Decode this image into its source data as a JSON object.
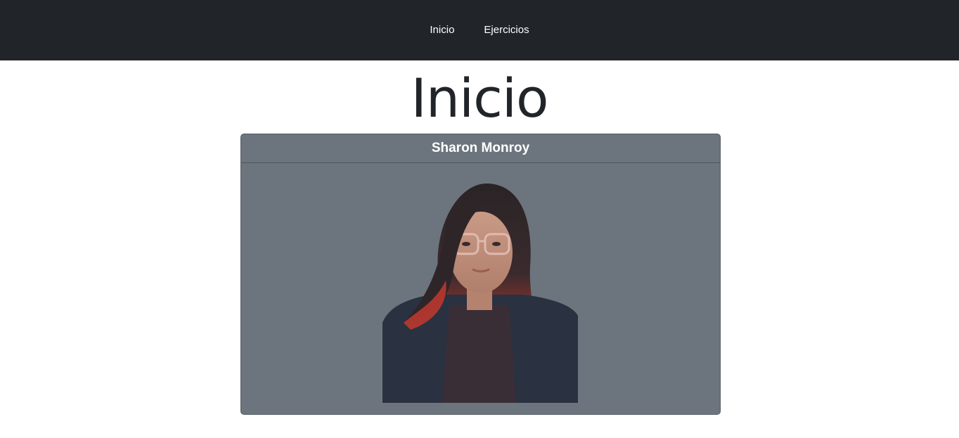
{
  "nav": {
    "items": [
      {
        "label": "Inicio"
      },
      {
        "label": "Ejercicios"
      }
    ],
    "background": "#212529"
  },
  "main": {
    "title": "Inicio"
  },
  "card": {
    "header": "Sharon Monroy",
    "background": "#6c757d",
    "image": {
      "subject": "portrait-photo"
    }
  }
}
